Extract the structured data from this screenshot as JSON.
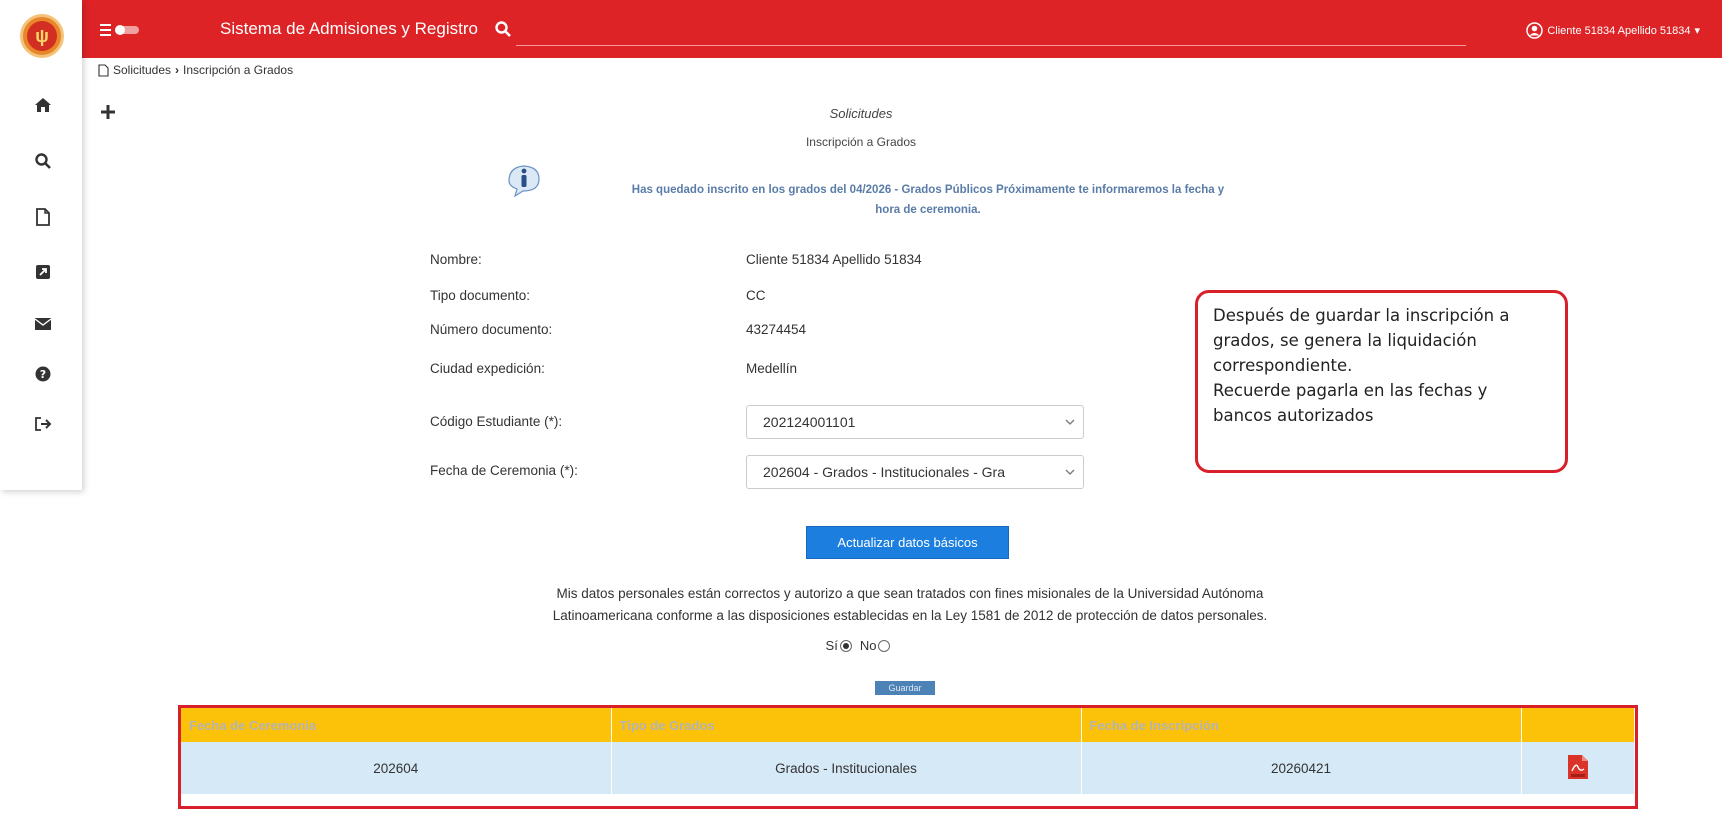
{
  "app": {
    "title": "Sistema de Admisiones y Registro",
    "user": "Cliente 51834 Apellido 51834"
  },
  "breadcrumb": {
    "parent": "Solicitudes",
    "current": "Inscripción a Grados"
  },
  "page": {
    "heading": "Solicitudes",
    "subheading": "Inscripción a Grados",
    "notice_line1": "Has quedado inscrito en los grados del 04/2026 - Grados Públicos Próximamente te informaremos la fecha y",
    "notice_line2": "hora de ceremonia."
  },
  "form": {
    "nombre_label": "Nombre:",
    "nombre_value": "Cliente 51834 Apellido 51834",
    "tipo_doc_label": "Tipo documento:",
    "tipo_doc_value": "CC",
    "num_doc_label": "Número documento:",
    "num_doc_value": "43274454",
    "ciudad_label": "Ciudad expedición:",
    "ciudad_value": "Medellín",
    "codigo_label": "Código Estudiante (*):",
    "codigo_value": "202124001101",
    "fecha_label": "Fecha de Ceremonia (*):",
    "fecha_value": "202604 - Grados - Institucionales - Gra"
  },
  "callout": {
    "line1": "Después de guardar la inscripción a",
    "line2": "grados, se genera la liquidación",
    "line3": "correspondiente.",
    "line4": "Recuerde pagarla en las fechas y",
    "line5": "bancos autorizados"
  },
  "buttons": {
    "update": "Actualizar datos básicos",
    "save": "Guardar"
  },
  "consent": {
    "line1": "Mis datos personales están correctos y autorizo a que sean tratados con fines misionales de la Universidad Autónoma",
    "line2": "Latinoamericana conforme a las disposiciones establecidas en la Ley 1581 de 2012 de protección de datos personales.",
    "yes": "Sí",
    "no": "No",
    "selected": "Sí"
  },
  "table": {
    "headers": [
      "Fecha de Ceremonia",
      "Tipo de Grados",
      "Fecha de Inscripción",
      ""
    ],
    "rows": [
      [
        "202604",
        "Grados - Institucionales",
        "20260421"
      ]
    ]
  },
  "colors": {
    "topbar": "#dd2326",
    "table_header": "#fcc20a",
    "table_row": "#d6e9f7",
    "primary_button": "#1c7fe0",
    "callout_border": "#d8202a"
  },
  "icons": [
    "home-icon",
    "search-icon",
    "document-icon",
    "external-link-icon",
    "envelope-icon",
    "help-icon",
    "sign-out-icon",
    "pdf-icon",
    "info-icon",
    "plus-icon",
    "user-circle-icon"
  ]
}
